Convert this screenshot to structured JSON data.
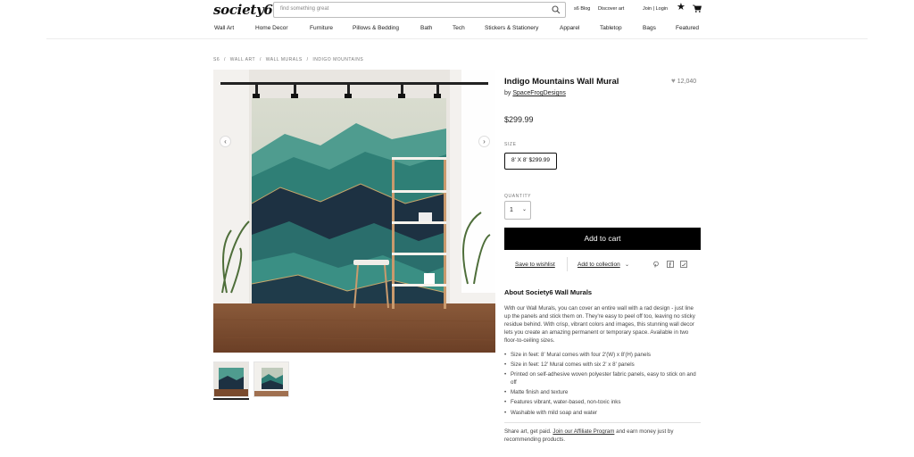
{
  "header": {
    "logo": "society6",
    "search_placeholder": "find something great",
    "links": [
      "s6 Blog",
      "Discover art",
      "Join | Login"
    ]
  },
  "nav": [
    "Wall Art",
    "Home Decor",
    "Furniture",
    "Pillows & Bedding",
    "Bath",
    "Tech",
    "Stickers & Stationery",
    "Apparel",
    "Tabletop",
    "Bags",
    "Featured"
  ],
  "breadcrumb": [
    "S6",
    "/",
    "WALL ART",
    "/",
    "WALL MURALS",
    "/",
    "INDIGO MOUNTAINS"
  ],
  "product": {
    "title": "Indigo Mountains Wall Mural",
    "by_label": "by",
    "artist": "SpaceFrogDesigns",
    "likes": "12,040",
    "price": "$299.99",
    "size_label": "SIZE",
    "size_option": "8' X 8' $299.99",
    "quantity_label": "QUANTITY",
    "quantity_value": "1",
    "add_to_cart": "Add to cart",
    "save_to_wishlist": "Save to wishlist",
    "add_to_collection": "Add to collection"
  },
  "about": {
    "heading": "About Society6 Wall Murals",
    "paragraph": "With our Wall Murals, you can cover an entire wall with a rad design - just line up the panels and stick them on. They're easy to peel off too, leaving no sticky residue behind. With crisp, vibrant colors and images, this stunning wall decor lets you create an amazing permanent or temporary space. Available in two floor-to-ceiling sizes.",
    "bullets": [
      "Size in feet: 8' Mural comes with four 2'(W) x 8'(H) panels",
      "Size in feet: 12' Mural comes with six 2' x 8' panels",
      "Printed on self-adhesive woven polyester fabric panels, easy to stick on and off",
      "Matte finish and texture",
      "Features vibrant, water-based, non-toxic inks",
      "Washable with mild soap and water"
    ],
    "share_pre": "Share art, get paid.",
    "share_link": "Join our Affiliate Program",
    "share_post": "and earn money just by recommending products."
  },
  "icons": {
    "search": "search-icon",
    "star": "star-icon",
    "cart": "cart-icon",
    "heart": "heart-icon",
    "prev": "chevron-left-icon",
    "next": "chevron-right-icon",
    "pinterest": "pinterest-icon",
    "facebook": "facebook-icon",
    "twitter": "twitter-icon"
  },
  "colors": {
    "button_bg": "#000000",
    "mural_teal": "#2f7f76",
    "mural_navy": "#1d3142",
    "gold_accent": "#c9a76a"
  }
}
